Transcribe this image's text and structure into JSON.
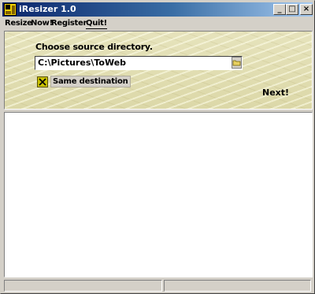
{
  "window": {
    "title": "iResizer 1.0",
    "minimize_glyph": "_",
    "maximize_glyph": "□",
    "close_glyph": "×"
  },
  "menu": {
    "items": [
      "Resize",
      "Now!",
      "Register",
      "Quit!"
    ]
  },
  "source": {
    "label": "Choose source directory.",
    "path": "C:\\Pictures\\ToWeb",
    "browse_icon": "folder-icon"
  },
  "options": {
    "same_destination_label": "Same destination",
    "same_destination_checked": true
  },
  "next_label": "Next!",
  "status": {
    "pane1": "",
    "pane2": ""
  },
  "colors": {
    "titlebar_start": "#0a246a",
    "titlebar_end": "#a6caf0",
    "panel_background": "#e2dfb4",
    "checkbox_fill": "#c8c000"
  }
}
